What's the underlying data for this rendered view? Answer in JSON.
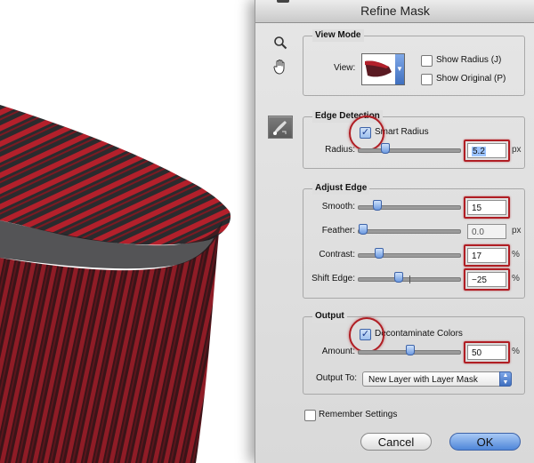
{
  "dialog": {
    "title": "Refine Mask"
  },
  "tools": {
    "zoom_icon": "zoom-icon",
    "hand_icon": "hand-icon",
    "brush_icon": "refine-radius-icon"
  },
  "view_mode": {
    "title": "View Mode",
    "view_label": "View:",
    "show_radius": "Show Radius (J)",
    "show_original": "Show Original (P)"
  },
  "edge_detection": {
    "title": "Edge Detection",
    "smart_radius": "Smart Radius",
    "smart_radius_checked": true,
    "radius_label": "Radius:",
    "radius_value": "5.2",
    "radius_unit": "px",
    "radius_fraction": 0.24
  },
  "adjust_edge": {
    "title": "Adjust Edge",
    "rows": [
      {
        "label": "Smooth:",
        "value": "15",
        "unit": "",
        "fraction": 0.15
      },
      {
        "label": "Feather:",
        "value": "0.0",
        "unit": "px",
        "fraction": 0.0
      },
      {
        "label": "Contrast:",
        "value": "17",
        "unit": "%",
        "fraction": 0.17
      },
      {
        "label": "Shift Edge:",
        "value": "−25",
        "unit": "%",
        "fraction": 0.375
      }
    ]
  },
  "output": {
    "title": "Output",
    "decontaminate": "Decontaminate Colors",
    "decontaminate_checked": true,
    "amount_label": "Amount:",
    "amount_value": "50",
    "amount_unit": "%",
    "amount_fraction": 0.5,
    "output_to_label": "Output To:",
    "output_to_value": "New Layer with Layer Mask"
  },
  "remember_settings": "Remember Settings",
  "buttons": {
    "cancel": "Cancel",
    "ok": "OK"
  },
  "colors": {
    "highlight": "#b01e24",
    "fabric_red": "#b3202b",
    "fabric_dark": "#2b2b2e",
    "accent": "#3d63a8"
  }
}
